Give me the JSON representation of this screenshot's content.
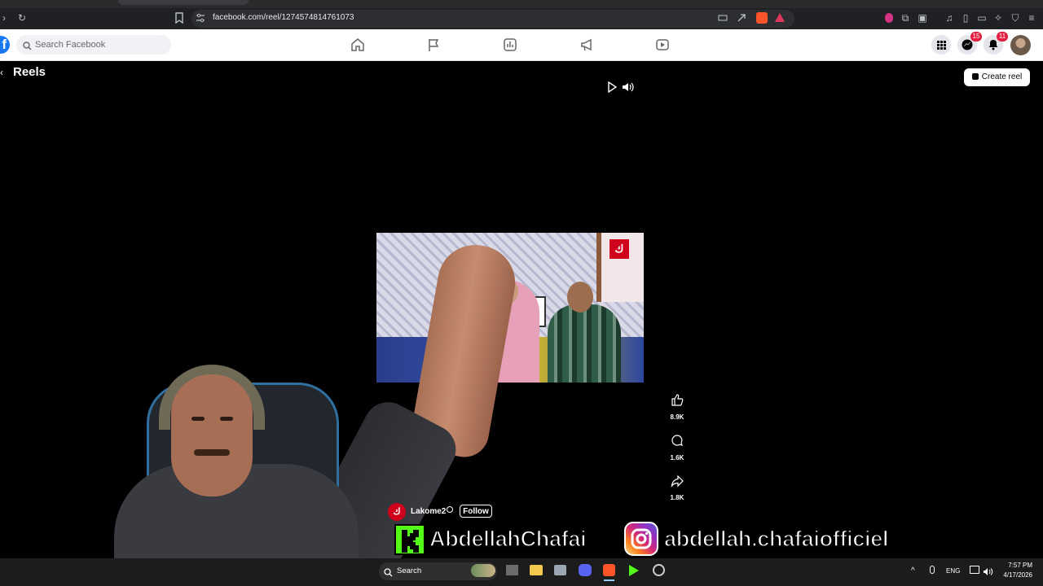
{
  "browser": {
    "url": "facebook.com/reel/1274574814761073"
  },
  "facebook": {
    "search_placeholder": "Search Facebook",
    "nav_icons": [
      "home-icon",
      "pages-flag-icon",
      "ads-manager-icon",
      "megaphone-icon",
      "video-icon"
    ],
    "messenger_badge": "15",
    "notifications_badge": "11",
    "brand_color": "#1877f2"
  },
  "reels": {
    "title": "Reels",
    "create_reel_label": "Create reel",
    "actions": {
      "likes": "8.9K",
      "comments": "1.6K",
      "shares": "1.8K"
    },
    "channel_name": "Lakome2",
    "follow_label": "Follow"
  },
  "overlay": {
    "kick_name": "AbdellahChafai",
    "instagram_name": "abdellah.chafaiofficiel"
  },
  "taskbar": {
    "search_label": "Search",
    "language": "ENG",
    "time": "7:57 PM",
    "date": "4/17/2026"
  }
}
